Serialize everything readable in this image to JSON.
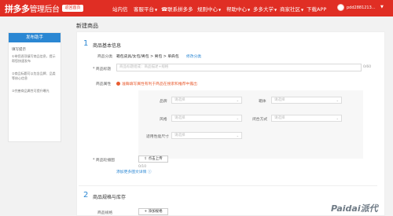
{
  "header": {
    "logo": "拼多多",
    "logo_sub": "管理后台",
    "home_badge": "返回首页",
    "nav": [
      "站内信",
      "客服平台",
      "联系拼多多",
      "规则中心",
      "帮助中心",
      "多多大学",
      "商家社区",
      "下载APP"
    ],
    "user": "pdd2881213..."
  },
  "sidebar": {
    "publish": "发布助手",
    "tips_title": "填写提示",
    "tips": [
      "①带您逐项填写商品信息，提示帮您快速发布",
      "②商品标题可以包含品牌、品类等核心信息",
      "③完善商品属性可提升曝光"
    ]
  },
  "main": {
    "page_title": "新建商品",
    "section1": {
      "num": "1",
      "title": "商品基本信息"
    },
    "category": {
      "label": "商品分类",
      "value": "箱包皮具/女包/男包 > 男包 > 单肩包",
      "action": "修改分类"
    },
    "title_field": {
      "label": "* 商品标题",
      "placeholder": "商品标题组成：商品描述+规格",
      "counter": "0/60"
    },
    "attrs": {
      "label": "商品属性",
      "warning": "准确填写属性有利于商品在搜索和推荐中露出",
      "rows": [
        {
          "left": "品牌",
          "right": "箱体"
        },
        {
          "left": "风格",
          "right": "闭合方式"
        },
        {
          "left": "适用性能尺寸",
          "right": ""
        }
      ],
      "select_placeholder": "请选择"
    },
    "photos": {
      "label": "* 商品轮播图",
      "upload": "点击上传",
      "upload_count": "0/10",
      "more": "添加更多图文详情"
    },
    "section2": {
      "num": "2",
      "title": "商品规格与库存"
    },
    "spec": {
      "label": "商品规格",
      "add": "+ 添加规格"
    }
  },
  "watermark": "Paidai派代"
}
